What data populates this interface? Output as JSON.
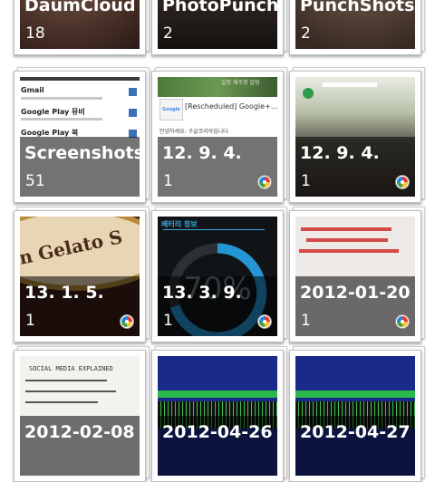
{
  "albums": [
    {
      "name": "DaumCloud",
      "count": "18",
      "source": "phone",
      "style": "face"
    },
    {
      "name": "PhotoPunch",
      "count": "2",
      "source": "phone",
      "style": "dark"
    },
    {
      "name": "PunchShots",
      "count": "2",
      "source": "phone",
      "style": "skin"
    },
    {
      "name": "Screenshots",
      "count": "51",
      "source": "phone",
      "style": "gmail",
      "preview": [
        "Gmail",
        "Google Play 뮤비",
        "Google Play 북"
      ]
    },
    {
      "name": "12. 9. 4.",
      "count": "1",
      "source": "picasa",
      "style": "email",
      "preview": [
        "[Rescheduled] Google+…",
        "안녕하세요: 구글코리아입니다.",
        "일정 재조정 알림"
      ]
    },
    {
      "name": "12. 9. 4.",
      "count": "1",
      "source": "picasa",
      "style": "crowd"
    },
    {
      "name": "13. 1. 5.",
      "count": "1",
      "source": "picasa",
      "style": "gelato",
      "preview": [
        "n Gelato S"
      ]
    },
    {
      "name": "13. 3. 9.",
      "count": "1",
      "source": "picasa",
      "style": "battery",
      "preview": [
        "배터리 정보",
        "70%"
      ]
    },
    {
      "name": "2012-01-20",
      "count": "1",
      "source": "picasa",
      "style": "text"
    },
    {
      "name": "2012-02-08",
      "count": "",
      "source": "phone",
      "style": "whiteboard",
      "preview": [
        "SOCIAL MEDIA EXPLAINED"
      ]
    },
    {
      "name": "2012-04-26",
      "count": "",
      "source": "phone",
      "style": "terminal"
    },
    {
      "name": "2012-04-27",
      "count": "",
      "source": "phone",
      "style": "terminal"
    }
  ],
  "colors": {
    "picasa_badge": [
      "#e53935",
      "#fbc02d",
      "#43a047",
      "#1e88e5"
    ]
  }
}
